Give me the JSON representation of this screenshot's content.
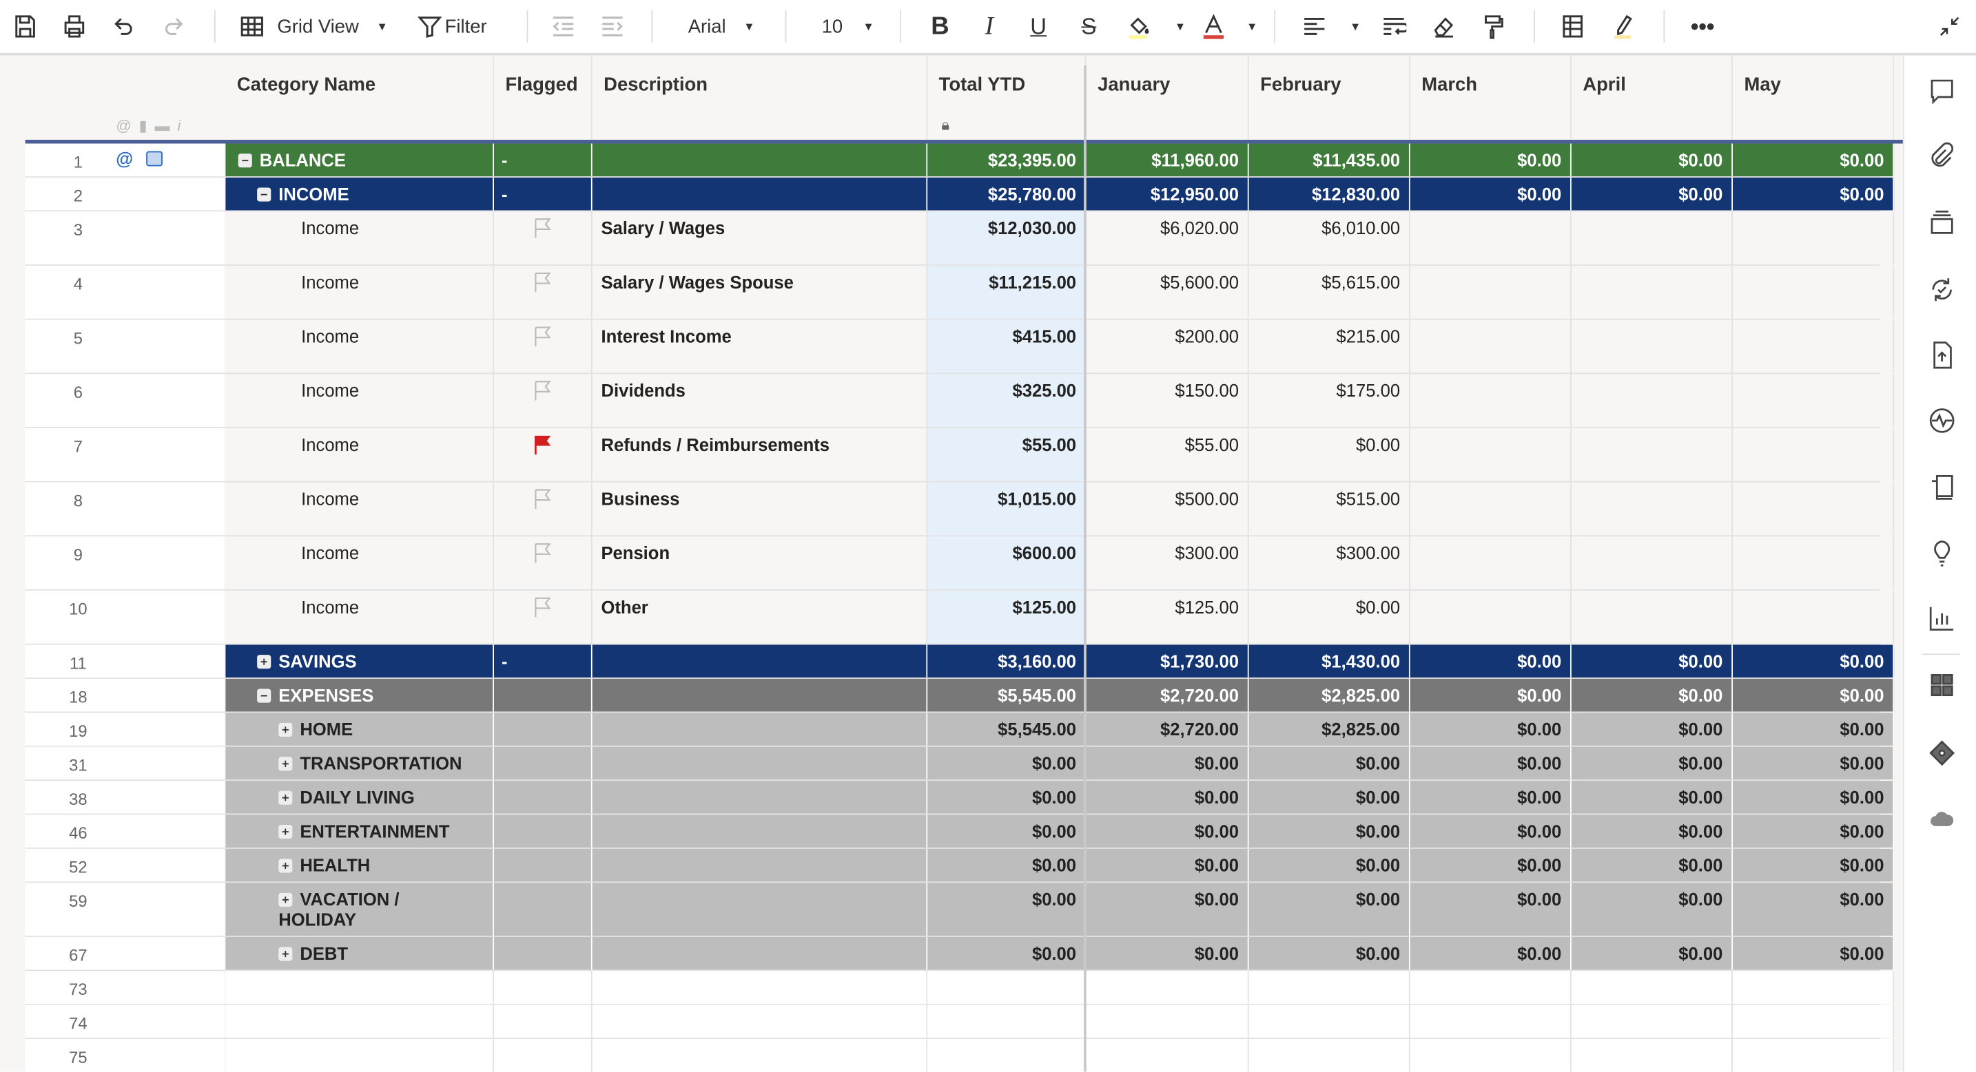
{
  "toolbar": {
    "view_label": "Grid View",
    "filter_label": "Filter",
    "font": "Arial",
    "font_size": "10",
    "fill_color": "#fdf89a",
    "text_color": "#d9443a",
    "highlight_color": "#fde9a6"
  },
  "columns": [
    "Category Name",
    "Flagged",
    "Description",
    "Total YTD",
    "January",
    "February",
    "March",
    "April",
    "May"
  ],
  "colors": {
    "balance": "#3f7b3b",
    "income": "#133574",
    "expenses": "#787878",
    "expense_child": "#bdbdbd",
    "ytd_highlight": "#e5f0fb",
    "flag_red": "#d21f1f"
  },
  "rows": [
    {
      "num": "1",
      "type": "balance",
      "level": 0,
      "toggle": "minus",
      "category": "BALANCE",
      "flag": "-",
      "description": "",
      "values": [
        "$23,395.00",
        "$11,960.00",
        "$11,435.00",
        "$0.00",
        "$0.00",
        "$0.00"
      ],
      "icons": true
    },
    {
      "num": "2",
      "type": "income",
      "level": 1,
      "toggle": "minus",
      "category": "INCOME",
      "flag": "-",
      "description": "",
      "values": [
        "$25,780.00",
        "$12,950.00",
        "$12,830.00",
        "$0.00",
        "$0.00",
        "$0.00"
      ]
    },
    {
      "num": "3",
      "type": "child",
      "level": 2,
      "category": "Income",
      "flagged": false,
      "description": "Salary / Wages",
      "values": [
        "$12,030.00",
        "$6,020.00",
        "$6,010.00",
        "",
        "",
        ""
      ]
    },
    {
      "num": "4",
      "type": "child",
      "level": 2,
      "category": "Income",
      "flagged": false,
      "description": "Salary / Wages Spouse",
      "values": [
        "$11,215.00",
        "$5,600.00",
        "$5,615.00",
        "",
        "",
        ""
      ]
    },
    {
      "num": "5",
      "type": "child",
      "level": 2,
      "category": "Income",
      "flagged": false,
      "description": "Interest Income",
      "values": [
        "$415.00",
        "$200.00",
        "$215.00",
        "",
        "",
        ""
      ]
    },
    {
      "num": "6",
      "type": "child",
      "level": 2,
      "category": "Income",
      "flagged": false,
      "description": "Dividends",
      "values": [
        "$325.00",
        "$150.00",
        "$175.00",
        "",
        "",
        ""
      ]
    },
    {
      "num": "7",
      "type": "child",
      "level": 2,
      "category": "Income",
      "flagged": true,
      "description": "Refunds / Reimbursements",
      "values": [
        "$55.00",
        "$55.00",
        "$0.00",
        "",
        "",
        ""
      ]
    },
    {
      "num": "8",
      "type": "child",
      "level": 2,
      "category": "Income",
      "flagged": false,
      "description": "Business",
      "values": [
        "$1,015.00",
        "$500.00",
        "$515.00",
        "",
        "",
        ""
      ]
    },
    {
      "num": "9",
      "type": "child",
      "level": 2,
      "category": "Income",
      "flagged": false,
      "description": "Pension",
      "values": [
        "$600.00",
        "$300.00",
        "$300.00",
        "",
        "",
        ""
      ]
    },
    {
      "num": "10",
      "type": "child",
      "level": 2,
      "category": "Income",
      "flagged": false,
      "description": "Other",
      "values": [
        "$125.00",
        "$125.00",
        "$0.00",
        "",
        "",
        ""
      ]
    },
    {
      "num": "11",
      "type": "income",
      "level": 1,
      "toggle": "plus",
      "category": "SAVINGS",
      "flag": "-",
      "description": "",
      "values": [
        "$3,160.00",
        "$1,730.00",
        "$1,430.00",
        "$0.00",
        "$0.00",
        "$0.00"
      ]
    },
    {
      "num": "18",
      "type": "expenses",
      "level": 1,
      "toggle": "minus",
      "category": "EXPENSES",
      "flag": "",
      "description": "",
      "values": [
        "$5,545.00",
        "$2,720.00",
        "$2,825.00",
        "$0.00",
        "$0.00",
        "$0.00"
      ]
    },
    {
      "num": "19",
      "type": "exp",
      "level": 2,
      "toggle": "plus",
      "category": "HOME",
      "values": [
        "$5,545.00",
        "$2,720.00",
        "$2,825.00",
        "$0.00",
        "$0.00",
        "$0.00"
      ]
    },
    {
      "num": "31",
      "type": "exp",
      "level": 2,
      "toggle": "plus",
      "category": "TRANSPORTATION",
      "values": [
        "$0.00",
        "$0.00",
        "$0.00",
        "$0.00",
        "$0.00",
        "$0.00"
      ]
    },
    {
      "num": "38",
      "type": "exp",
      "level": 2,
      "toggle": "plus",
      "category": "DAILY LIVING",
      "values": [
        "$0.00",
        "$0.00",
        "$0.00",
        "$0.00",
        "$0.00",
        "$0.00"
      ]
    },
    {
      "num": "46",
      "type": "exp",
      "level": 2,
      "toggle": "plus",
      "category": "ENTERTAINMENT",
      "values": [
        "$0.00",
        "$0.00",
        "$0.00",
        "$0.00",
        "$0.00",
        "$0.00"
      ]
    },
    {
      "num": "52",
      "type": "exp",
      "level": 2,
      "toggle": "plus",
      "category": "HEALTH",
      "values": [
        "$0.00",
        "$0.00",
        "$0.00",
        "$0.00",
        "$0.00",
        "$0.00"
      ]
    },
    {
      "num": "59",
      "type": "exp",
      "level": 2,
      "toggle": "plus",
      "category": "VACATION / HOLIDAY",
      "values": [
        "$0.00",
        "$0.00",
        "$0.00",
        "$0.00",
        "$0.00",
        "$0.00"
      ],
      "tall": true
    },
    {
      "num": "67",
      "type": "exp",
      "level": 2,
      "toggle": "plus",
      "category": "DEBT",
      "values": [
        "$0.00",
        "$0.00",
        "$0.00",
        "$0.00",
        "$0.00",
        "$0.00"
      ]
    },
    {
      "num": "73",
      "type": "empty",
      "values": []
    },
    {
      "num": "74",
      "type": "empty",
      "values": []
    },
    {
      "num": "75",
      "type": "empty",
      "values": []
    }
  ],
  "sidebar_icons": [
    "comment-icon",
    "attachment-icon",
    "proofs-icon",
    "update-requests-icon",
    "publish-icon",
    "activity-icon",
    "forms-icon",
    "summary-icon",
    "dashboard-icon",
    "apps-icon",
    "diamond-icon",
    "cloud-icon"
  ]
}
